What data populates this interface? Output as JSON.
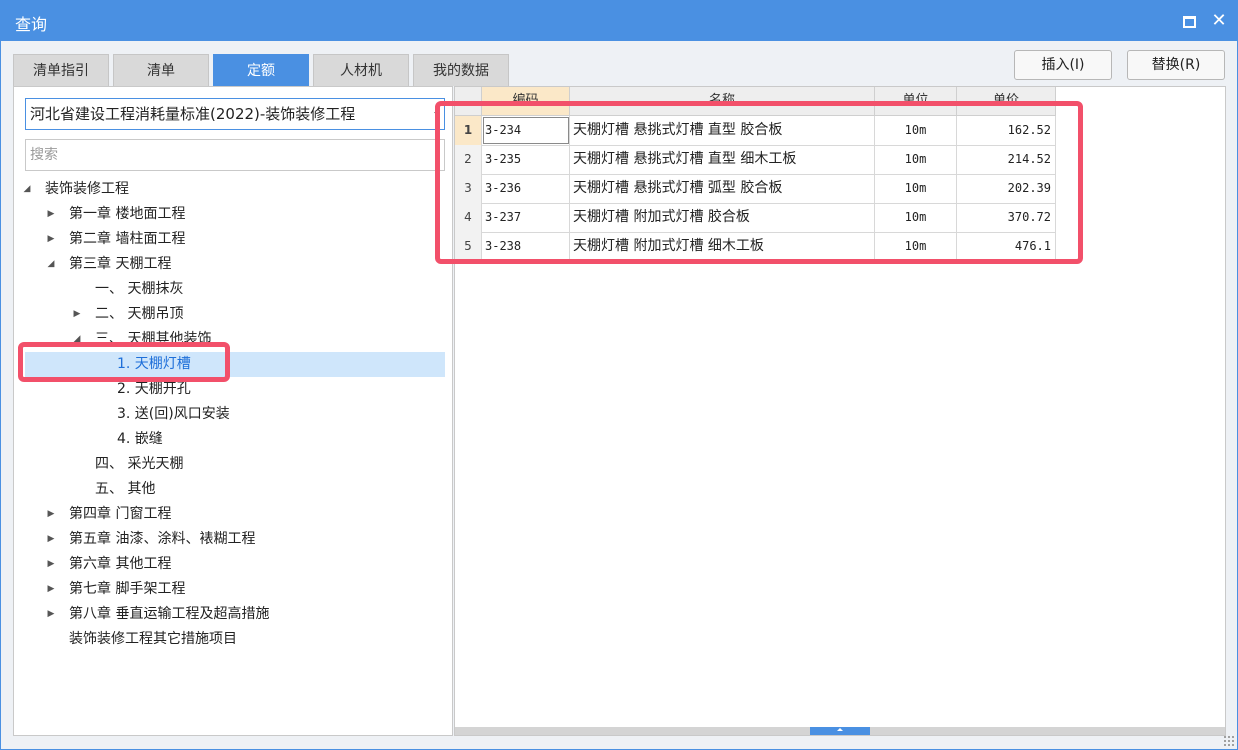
{
  "window": {
    "title": "查询",
    "maximize_icon": "maximize-icon",
    "close_glyph": "✕",
    "accent_color": "#4a90e2",
    "highlight_color": "#f2506a"
  },
  "tabs": [
    {
      "label": "清单指引",
      "active": false
    },
    {
      "label": "清单",
      "active": false
    },
    {
      "label": "定额",
      "active": true
    },
    {
      "label": "人材机",
      "active": false
    },
    {
      "label": "我的数据",
      "active": false
    }
  ],
  "actions": {
    "insert_label": "插入(I)",
    "replace_label": "替换(R)"
  },
  "library": {
    "selected": "河北省建设工程消耗量标准(2022)-装饰装修工程"
  },
  "search": {
    "placeholder": "搜索",
    "value": ""
  },
  "tree": [
    {
      "label": "装饰装修工程",
      "level": 0,
      "state": "expanded",
      "selected": false
    },
    {
      "label": "第一章 楼地面工程",
      "level": 1,
      "state": "collapsed",
      "selected": false
    },
    {
      "label": "第二章 墙柱面工程",
      "level": 1,
      "state": "collapsed",
      "selected": false
    },
    {
      "label": "第三章 天棚工程",
      "level": 1,
      "state": "expanded",
      "selected": false
    },
    {
      "label": "一、 天棚抹灰",
      "level": 2,
      "state": "leaf",
      "selected": false
    },
    {
      "label": "二、 天棚吊顶",
      "level": 2,
      "state": "collapsed",
      "selected": false
    },
    {
      "label": "三、 天棚其他装饰",
      "level": 2,
      "state": "expanded",
      "selected": false
    },
    {
      "label": "1. 天棚灯槽",
      "level": 3,
      "state": "leaf",
      "selected": true
    },
    {
      "label": "2. 天棚开孔",
      "level": 3,
      "state": "leaf",
      "selected": false
    },
    {
      "label": "3. 送(回)风口安装",
      "level": 3,
      "state": "leaf",
      "selected": false
    },
    {
      "label": "4. 嵌缝",
      "level": 3,
      "state": "leaf",
      "selected": false
    },
    {
      "label": "四、 采光天棚",
      "level": 2,
      "state": "leaf",
      "selected": false
    },
    {
      "label": "五、 其他",
      "level": 2,
      "state": "leaf",
      "selected": false
    },
    {
      "label": "第四章 门窗工程",
      "level": 1,
      "state": "collapsed",
      "selected": false
    },
    {
      "label": "第五章 油漆、涂料、裱糊工程",
      "level": 1,
      "state": "collapsed",
      "selected": false
    },
    {
      "label": "第六章 其他工程",
      "level": 1,
      "state": "collapsed",
      "selected": false
    },
    {
      "label": "第七章 脚手架工程",
      "level": 1,
      "state": "collapsed",
      "selected": false
    },
    {
      "label": "第八章 垂直运输工程及超高措施",
      "level": 1,
      "state": "collapsed",
      "selected": false
    },
    {
      "label": "装饰装修工程其它措施项目",
      "level": 1,
      "state": "leaf",
      "selected": false
    }
  ],
  "grid": {
    "columns": [
      "",
      "编码",
      "名称",
      "单位",
      "单价"
    ],
    "sorted_column": 1,
    "rows": [
      {
        "num": "1",
        "code": "3-234",
        "name": "天棚灯槽 悬挑式灯槽 直型 胶合板",
        "unit": "10m",
        "price": "162.52"
      },
      {
        "num": "2",
        "code": "3-235",
        "name": "天棚灯槽 悬挑式灯槽 直型 细木工板",
        "unit": "10m",
        "price": "214.52"
      },
      {
        "num": "3",
        "code": "3-236",
        "name": "天棚灯槽 悬挑式灯槽 弧型 胶合板",
        "unit": "10m",
        "price": "202.39"
      },
      {
        "num": "4",
        "code": "3-237",
        "name": "天棚灯槽 附加式灯槽 胶合板",
        "unit": "10m",
        "price": "370.72"
      },
      {
        "num": "5",
        "code": "3-238",
        "name": "天棚灯槽 附加式灯槽 细木工板",
        "unit": "10m",
        "price": "476.1"
      }
    ]
  }
}
